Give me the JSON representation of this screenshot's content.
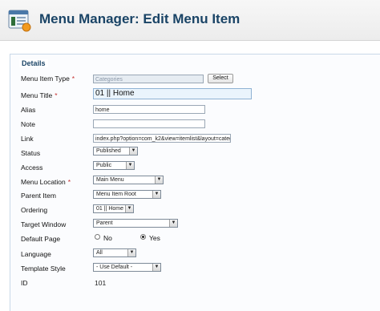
{
  "header": {
    "title": "Menu Manager: Edit Menu Item"
  },
  "details": {
    "legend": "Details",
    "menu_item_type": {
      "label": "Menu Item Type",
      "value": "Categories",
      "button": "Select"
    },
    "menu_title": {
      "label": "Menu Title",
      "value": "01 || Home"
    },
    "alias": {
      "label": "Alias",
      "value": "home"
    },
    "note": {
      "label": "Note",
      "value": ""
    },
    "link": {
      "label": "Link",
      "value": "index.php?option=com_k2&view=itemlist&layout=categ"
    },
    "status": {
      "label": "Status",
      "value": "Published"
    },
    "access": {
      "label": "Access",
      "value": "Public"
    },
    "menu_location": {
      "label": "Menu Location",
      "value": "Main Menu"
    },
    "parent_item": {
      "label": "Parent Item",
      "value": "Menu Item Root"
    },
    "ordering": {
      "label": "Ordering",
      "value": "01 || Home"
    },
    "target_window": {
      "label": "Target Window",
      "value": "Parent"
    },
    "default_page": {
      "label": "Default Page",
      "no": "No",
      "yes": "Yes",
      "selected": "Yes"
    },
    "language": {
      "label": "Language",
      "value": "All"
    },
    "template_style": {
      "label": "Template Style",
      "value": "- Use Default -"
    },
    "id": {
      "label": "ID",
      "value": "101"
    },
    "required_mark": "*"
  }
}
